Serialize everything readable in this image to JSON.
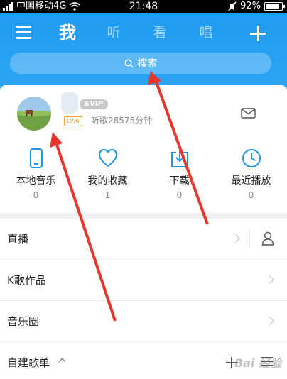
{
  "status_bar": {
    "carrier": "中国移动4G",
    "time": "21:48",
    "battery": "92%",
    "battery_level": 0.92
  },
  "header": {
    "tabs": [
      {
        "label": "我",
        "active": true
      },
      {
        "label": "听",
        "active": false
      },
      {
        "label": "看",
        "active": false
      },
      {
        "label": "唱",
        "active": false
      }
    ],
    "search_label": "搜索"
  },
  "profile": {
    "svip_badge": "SVIP",
    "level": "LV.6",
    "listen_time": "听歌28575分钟"
  },
  "stats": [
    {
      "label": "本地音乐",
      "count": "0",
      "icon": "phone-icon"
    },
    {
      "label": "我的收藏",
      "count": "1",
      "icon": "heart-icon"
    },
    {
      "label": "下载",
      "count": "0",
      "icon": "download-icon"
    },
    {
      "label": "最近播放",
      "count": "0",
      "icon": "clock-icon"
    }
  ],
  "menu": [
    {
      "label": "直播"
    },
    {
      "label": "K歌作品"
    },
    {
      "label": "音乐圈"
    },
    {
      "label": "自建歌单"
    }
  ],
  "watermark": "Bai 经验",
  "colors": {
    "header_blue": "#1f9bf0",
    "accent_blue": "#1e96e8",
    "level_orange": "#f5a623",
    "arrow_red": "#e8362d"
  }
}
